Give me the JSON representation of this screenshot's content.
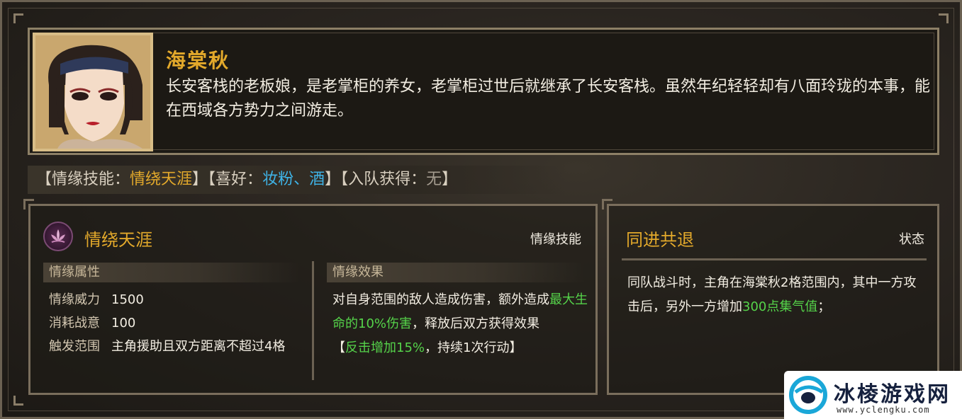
{
  "character": {
    "name": "海棠秋",
    "description": "长安客栈的老板娘，是老掌柜的养女，老掌柜过世后就继承了长安客栈。虽然年纪轻轻却有八面玲珑的本事，能在西域各方势力之间游走。"
  },
  "tags": {
    "skill_prefix": "【情缘技能：",
    "skill_value": "情绕天涯",
    "skill_suffix": "】",
    "hobby_prefix": "【喜好：",
    "hobby_value": "妆粉、酒",
    "hobby_suffix": "】",
    "join_prefix": "【入队获得：",
    "join_value": "无",
    "join_suffix": "】"
  },
  "skill": {
    "name": "情绕天涯",
    "kind": "情缘技能",
    "icon": "lotus-icon",
    "attrs_header": "情缘属性",
    "attrs": [
      {
        "key": "情缘威力",
        "value": "1500"
      },
      {
        "key": "消耗战意",
        "value": "100"
      },
      {
        "key": "触发范围",
        "value": "主角援助且双方距离不超过4格"
      }
    ],
    "effects_header": "情缘效果",
    "effect_a": "对自身范围的敌人造成伤害，额外造成",
    "effect_b_green": "最大生命的10%伤害",
    "effect_c": "，释放后双方获得效果",
    "effect_d": "【",
    "effect_e_green": "反击增加15%",
    "effect_f": "，持续1次行动】"
  },
  "state": {
    "name": "同进共退",
    "kind": "状态",
    "desc_a": "同队战斗时，主角在海棠秋2格范围内，其中一方攻击后，另外一方增加",
    "desc_b_green": "300点集气值",
    "desc_c": "；"
  },
  "watermark": {
    "text": "冰棱游戏网",
    "url": "www.yclengku.com"
  },
  "colors": {
    "gold": "#e3a92b",
    "blue": "#3fb3e6",
    "green": "#55d34a"
  }
}
